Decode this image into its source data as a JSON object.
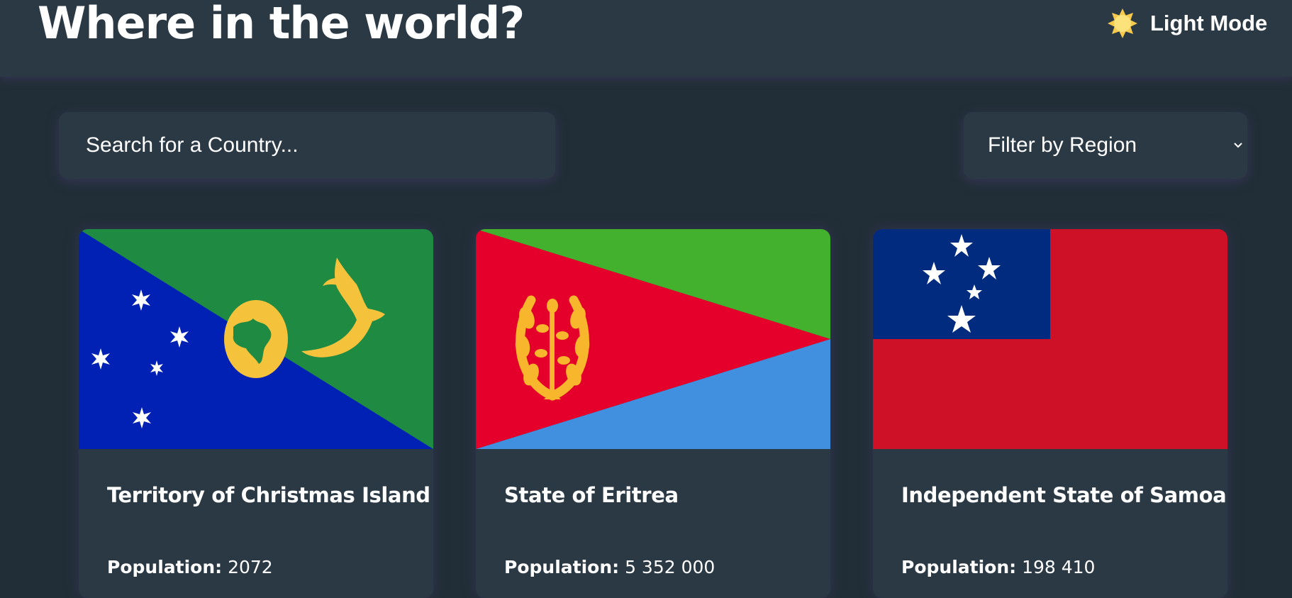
{
  "header": {
    "title": "Where in the world?",
    "mode_toggle": {
      "label": "Light Mode",
      "icon": "sun-icon"
    }
  },
  "search": {
    "placeholder": "Search for a Country...",
    "value": ""
  },
  "filter": {
    "label": "Filter by Region",
    "icon": "chevron-down-icon"
  },
  "cards": [
    {
      "name": "Territory of Christmas Island",
      "population_label": "Population:",
      "population": "2072",
      "flag": "christmas-island-flag"
    },
    {
      "name": "State of Eritrea",
      "population_label": "Population:",
      "population": "5 352 000",
      "flag": "eritrea-flag"
    },
    {
      "name": "Independent State of Samoa",
      "population_label": "Population:",
      "population": "198 410",
      "flag": "samoa-flag"
    }
  ],
  "colors": {
    "background": "#212e37",
    "surface": "#2b3945",
    "text": "#ffffff"
  }
}
